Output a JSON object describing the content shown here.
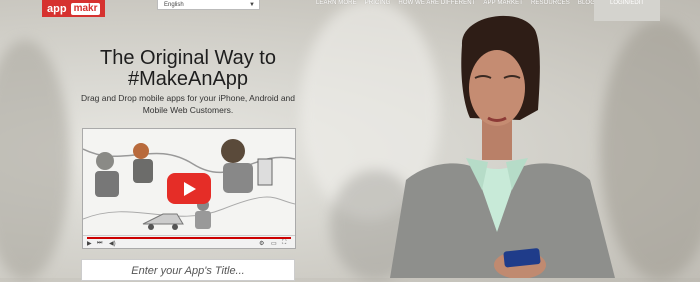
{
  "brand": {
    "part1": "app",
    "part2": "makr"
  },
  "language_select": {
    "value": "English"
  },
  "nav": [
    {
      "label": "LEARN MORE"
    },
    {
      "label": "PRICING"
    },
    {
      "label": "HOW WE ARE DIFFERENT"
    },
    {
      "label": "APP MARKET"
    },
    {
      "label": "RESOURCES"
    },
    {
      "label": "BLOG"
    }
  ],
  "login_label": "LOGIN/EDIT",
  "hero": {
    "headline_line1": "The Original Way to",
    "headline_line2": "#MakeAnApp",
    "sub_line1": "Drag and Drop mobile apps for your iPhone, Android and",
    "sub_line2": "Mobile Web Customers."
  },
  "video": {
    "progress": 1.0
  },
  "title_input": {
    "placeholder": "Enter your App's Title..."
  },
  "colors": {
    "brand_red": "#d6322f",
    "play_red": "#e52d27"
  }
}
